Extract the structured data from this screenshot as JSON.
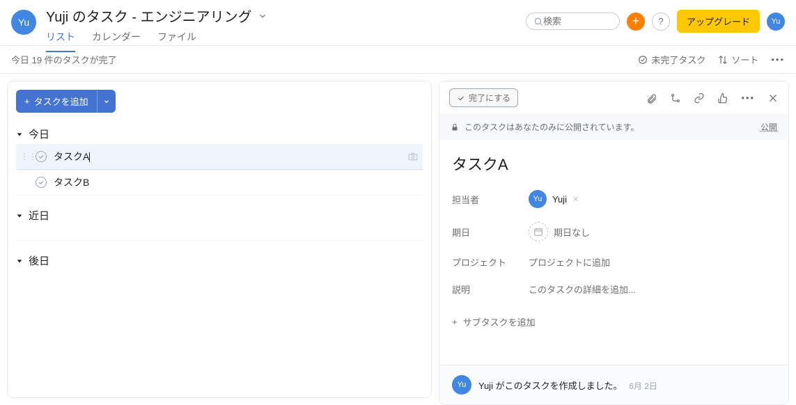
{
  "header": {
    "avatar_text": "Yu",
    "title": "Yuji のタスク - エンジニアリング",
    "tabs": {
      "list": "リスト",
      "calendar": "カレンダー",
      "files": "ファイル"
    },
    "search_placeholder": "検索",
    "upgrade": "アップグレード"
  },
  "toolbar": {
    "status": "今日 19 件のタスクが完了",
    "incomplete": "未完了タスク",
    "sort": "ソート"
  },
  "left": {
    "add_task": "タスクを追加",
    "sections": {
      "today": "今日",
      "soon": "近日",
      "later": "後日"
    },
    "tasks": {
      "a": "タスクA",
      "b": "タスクB"
    }
  },
  "detail": {
    "complete": "完了にする",
    "privacy_msg": "このタスクはあなたのみに公開されています。",
    "publish": "公開",
    "title": "タスクA",
    "labels": {
      "assignee": "担当者",
      "due": "期日",
      "project": "プロジェクト",
      "description": "説明"
    },
    "values": {
      "assignee_name": "Yuji",
      "assignee_av": "Yu",
      "due": "期日なし",
      "project": "プロジェクトに追加",
      "description": "このタスクの詳細を追加..."
    },
    "subtask": "サブタスクを追加",
    "activity": {
      "av": "Yu",
      "text": "Yuji がこのタスクを作成しました。",
      "date": "6月 2日"
    }
  }
}
